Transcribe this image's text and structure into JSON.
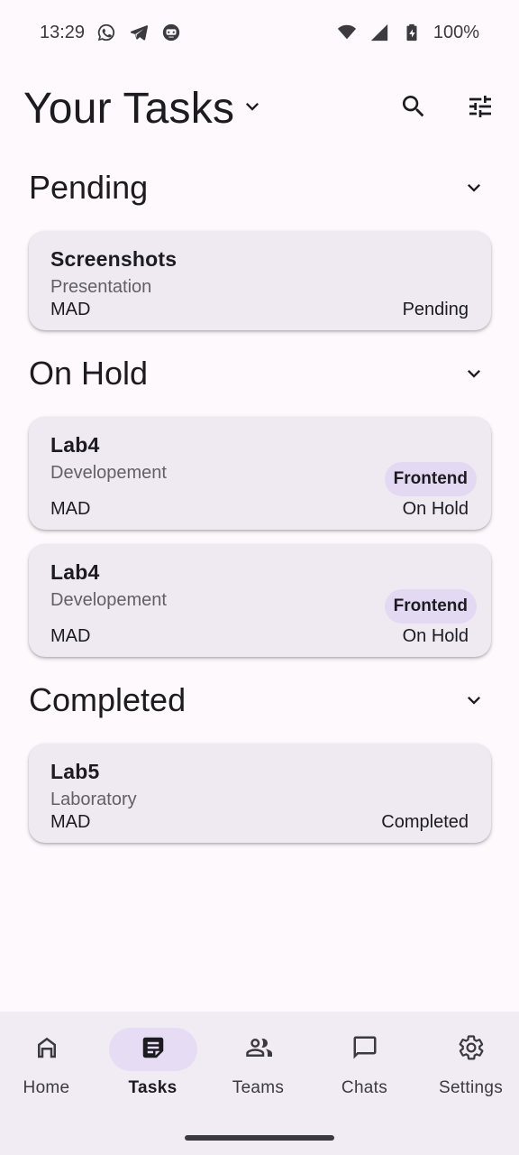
{
  "status_bar": {
    "time": "13:29",
    "battery": "100%",
    "left_icons": [
      "whatsapp-icon",
      "telegram-icon",
      "robot-icon"
    ],
    "right_icons": [
      "wifi-icon",
      "cell-signal-icon",
      "battery-icon"
    ]
  },
  "header": {
    "title": "Your Tasks",
    "icons": [
      "chevron-down-icon",
      "search-icon",
      "tune-icon"
    ]
  },
  "sections": {
    "pending": {
      "title": "Pending",
      "tasks": [
        {
          "title": "Screenshots",
          "type": "Presentation",
          "course": "MAD",
          "status": "Pending"
        }
      ]
    },
    "on_hold": {
      "title": "On Hold",
      "tasks": [
        {
          "title": "Lab4",
          "type": "Developement",
          "course": "MAD",
          "tag": "Frontend",
          "status": "On Hold"
        },
        {
          "title": "Lab4",
          "type": "Developement",
          "course": "MAD",
          "tag": "Frontend",
          "status": "On Hold"
        }
      ]
    },
    "completed": {
      "title": "Completed",
      "tasks": [
        {
          "title": "Lab5",
          "type": "Laboratory",
          "course": "MAD",
          "status": "Completed"
        }
      ]
    }
  },
  "bottom_nav": {
    "active": "Tasks",
    "items": [
      {
        "label": "Home",
        "icon": "home-icon"
      },
      {
        "label": "Tasks",
        "icon": "tasks-icon"
      },
      {
        "label": "Teams",
        "icon": "people-icon"
      },
      {
        "label": "Chats",
        "icon": "chat-icon"
      },
      {
        "label": "Settings",
        "icon": "gear-icon"
      }
    ]
  },
  "colors": {
    "background": "#fdf9fd",
    "card": "#efe9f1",
    "tag": "#e3d9f3",
    "nav_background": "#f1ecf4",
    "nav_active_pill": "#e6ddf5"
  }
}
